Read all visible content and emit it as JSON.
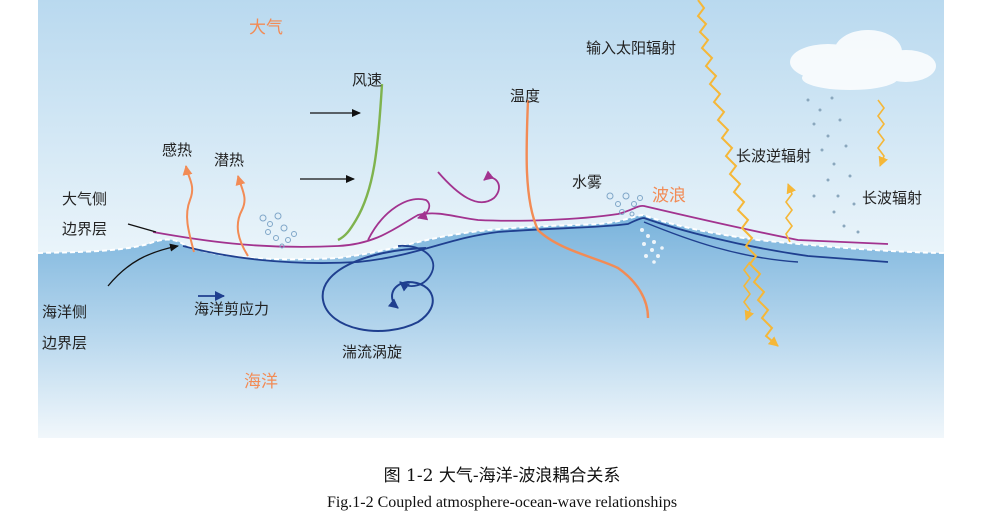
{
  "labels": {
    "atmosphere": "大气",
    "ocean": "海洋",
    "wave": "波浪",
    "wind_speed": "风速",
    "temperature": "温度",
    "input_solar": "输入太阳辐射",
    "sensible_heat": "感热",
    "latent_heat": "潜热",
    "atmo_boundary_1": "大气侧",
    "atmo_boundary_2": "边界层",
    "sea_spray": "水雾",
    "longwave_back": "长波逆辐射",
    "longwave": "长波辐射",
    "ocean_boundary_1": "海洋侧",
    "ocean_boundary_2": "边界层",
    "ocean_stress": "海洋剪应力",
    "eddy": "湍流涡旋"
  },
  "caption": {
    "cn": "图 1-2  大气-海洋-波浪耦合关系",
    "en": "Fig.1-2 Coupled atmosphere-ocean-wave relationships"
  },
  "colors": {
    "sky_top": "#bcdcf0",
    "sky_bottom": "#eaf5fb",
    "sea_top": "#7fb8df",
    "sea_bottom": "#eef6fb",
    "orange": "#f28b55",
    "wind_green": "#7fb34e",
    "purple": "#a2338f",
    "dark_blue": "#1f3f8f",
    "sun_yellow": "#f5b738"
  }
}
